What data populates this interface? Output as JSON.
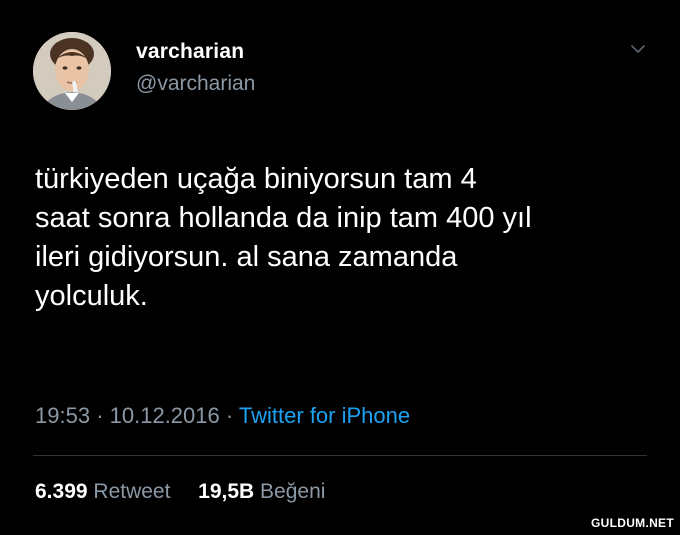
{
  "user": {
    "display_name": "varcharian",
    "handle": "@varcharian",
    "avatar": "child-portrait-avatar"
  },
  "tweet": {
    "text": "türkiyeden uçağa biniyorsun tam 4\nsaat sonra hollanda da inip tam 400 yıl\nileri gidiyorsun. al sana zamanda\nyolculuk.",
    "time": "19:53",
    "date": "10.12.2016",
    "separator": "·",
    "source": "Twitter for iPhone",
    "menu_icon": "chevron-down-icon"
  },
  "stats": {
    "retweets_count": "6.399",
    "retweets_label": "Retweet",
    "likes_count": "19,5B",
    "likes_label": "Beğeni"
  },
  "watermark": {
    "text": "GULDUM.NET"
  },
  "colors": {
    "background": "#000000",
    "text_primary": "#ffffff",
    "text_secondary": "#8b98a5",
    "link": "#1da1f2",
    "divider": "#2f3336"
  }
}
